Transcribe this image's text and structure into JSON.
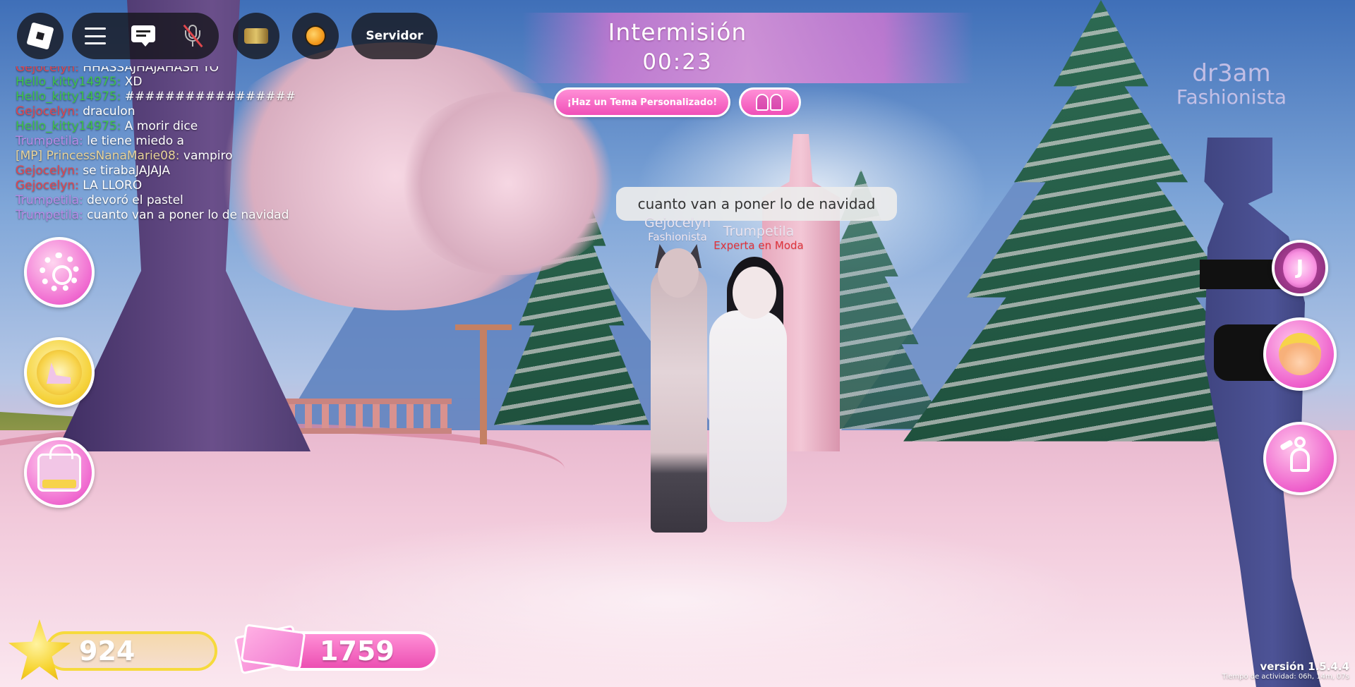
{
  "topbar": {
    "server_label": "Servidor"
  },
  "phase": {
    "title": "Intermisión",
    "timer": "00:23",
    "theme_button_label": "¡Haz un Tema Personalizado!"
  },
  "chat": {
    "lines": [
      {
        "name": "Gejocelyn:",
        "text": "HHASSAJHAJAHASH YO",
        "color": "#e0454f",
        "partial": true
      },
      {
        "name": "Hello_kitty14975:",
        "text": "XD",
        "color": "#3fc34a"
      },
      {
        "name": "Hello_kitty14975:",
        "text": "#################",
        "color": "#3fc34a"
      },
      {
        "name": "Gejocelyn:",
        "text": "draculon",
        "color": "#e0454f"
      },
      {
        "name": "Hello_kitty14975:",
        "text": "A morir dice",
        "color": "#3fc34a"
      },
      {
        "name": "Trumpetila:",
        "text": "le tiene miedo a",
        "color": "#b98be8"
      },
      {
        "name": "[MP] PrincessNanaMarie08:",
        "text": "vampiro",
        "color": "#e8d39a",
        "tag_color": "#111111"
      },
      {
        "name": "Gejocelyn:",
        "text": "se tirabaJAJAJA",
        "color": "#e0454f"
      },
      {
        "name": "Gejocelyn:",
        "text": "LA LLORO",
        "color": "#e0454f"
      },
      {
        "name": "Trumpetila:",
        "text": "devoró el pastel",
        "color": "#b98be8"
      },
      {
        "name": "Trumpetila:",
        "text": "cuanto van a poner lo de navidad",
        "color": "#b98be8"
      }
    ]
  },
  "speech_bubble": {
    "text": "cuanto van a poner lo de navidad"
  },
  "players": [
    {
      "name": "Gejocelyn",
      "title": "Fashionista",
      "title_color": "#efe6f0"
    },
    {
      "name": "Trumpetila",
      "title": "Experta en Moda",
      "title_color": "#e2343d"
    }
  ],
  "overlay_tag": {
    "name": "dr3am",
    "title": "Fashionista"
  },
  "currency": {
    "stars": "924",
    "cash": "1759"
  },
  "footer": {
    "version": "versión 1.5.4.4",
    "activity": "Tiempo de actividad: 06h, 14m, 07s"
  },
  "icons": {
    "roblox": "roblox-logo-icon",
    "menu": "hamburger-menu-icon",
    "chat": "chat-icon",
    "mic": "mic-muted-icon",
    "emote": "emote-icon",
    "music": "sun-icon",
    "settings": "gear-icon",
    "outfits": "heels-icon",
    "shop": "bag-icon",
    "jpop": "jpop-icon",
    "avatar": "face-icon",
    "pose": "pose-icon",
    "duo": "duo-icon",
    "stars": "star-icon",
    "cash": "cash-icon"
  }
}
